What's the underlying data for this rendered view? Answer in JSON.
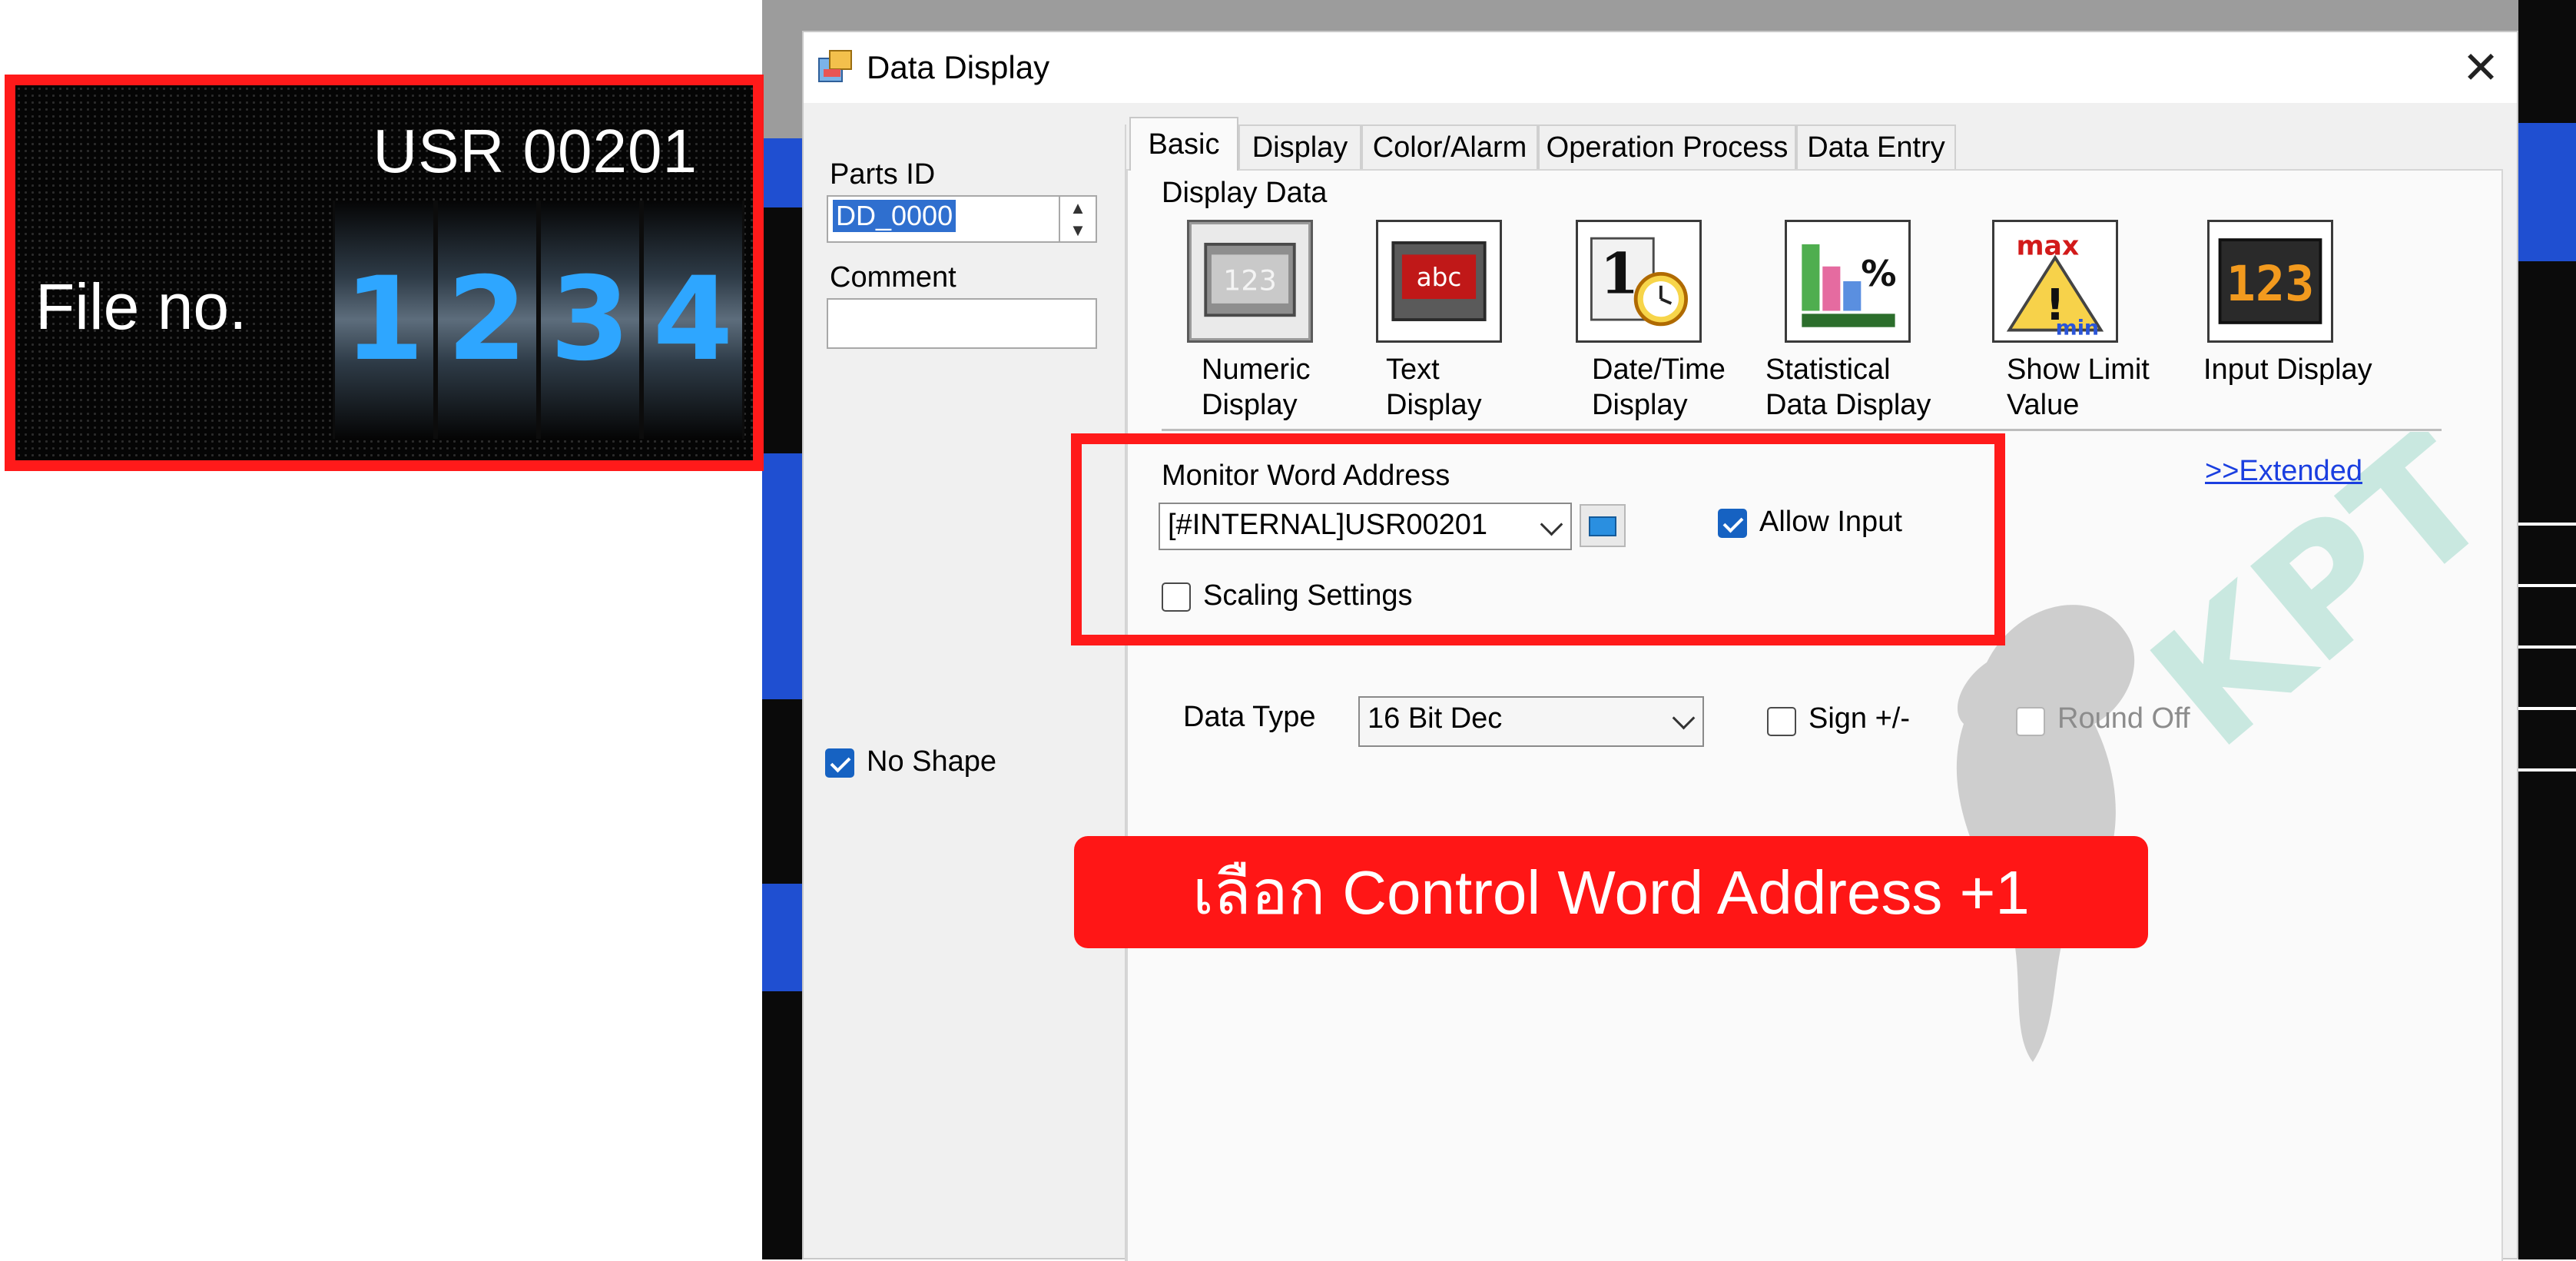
{
  "preview": {
    "address_title": "USR 00201",
    "label": "File no.",
    "digits": [
      "1",
      "2",
      "3",
      "4"
    ]
  },
  "dialog": {
    "title": "Data Display",
    "close_symbol": "✕"
  },
  "left_panel": {
    "parts_id_label": "Parts ID",
    "parts_id_value": "DD_0000",
    "comment_label": "Comment",
    "comment_value": "",
    "no_shape_label": "No Shape",
    "no_shape_checked": true
  },
  "tabs": [
    "Basic",
    "Display",
    "Color/Alarm",
    "Operation Process",
    "Data Entry"
  ],
  "active_tab": "Basic",
  "basic": {
    "display_data_label": "Display Data",
    "options": [
      {
        "caption_line1": "Numeric",
        "caption_line2": "Display",
        "icon": "numeric-display-icon",
        "selected": true
      },
      {
        "caption_line1": "Text",
        "caption_line2": "Display",
        "icon": "text-display-icon",
        "selected": false
      },
      {
        "caption_line1": "Date/Time",
        "caption_line2": "Display",
        "icon": "date-time-display-icon",
        "selected": false
      },
      {
        "caption_line1": "Statistical",
        "caption_line2": "Data Display",
        "icon": "statistical-data-display-icon",
        "selected": false
      },
      {
        "caption_line1": "Show Limit",
        "caption_line2": "Value",
        "icon": "show-limit-value-icon",
        "selected": false
      },
      {
        "caption_line1": "Input Display",
        "caption_line2": "",
        "icon": "input-display-icon",
        "selected": false
      }
    ],
    "extended_link": ">>Extended",
    "monitor_word_address_label": "Monitor Word Address",
    "monitor_word_address_value": "[#INTERNAL]USR00201",
    "allow_input_label": "Allow Input",
    "allow_input_checked": true,
    "scaling_settings_label": "Scaling Settings",
    "scaling_settings_checked": false,
    "data_type_label": "Data Type",
    "data_type_value": "16 Bit Dec",
    "sign_label": "Sign +/-",
    "sign_checked": false,
    "round_off_label": "Round Off",
    "round_off_checked": false
  },
  "annotation": {
    "banner_text": "เลือก Control Word Address +1"
  },
  "colors": {
    "highlight_red": "#ff1a1a",
    "digit_blue": "#2ea6ff",
    "check_blue": "#1662c2",
    "link_blue": "#1b3fe0"
  }
}
